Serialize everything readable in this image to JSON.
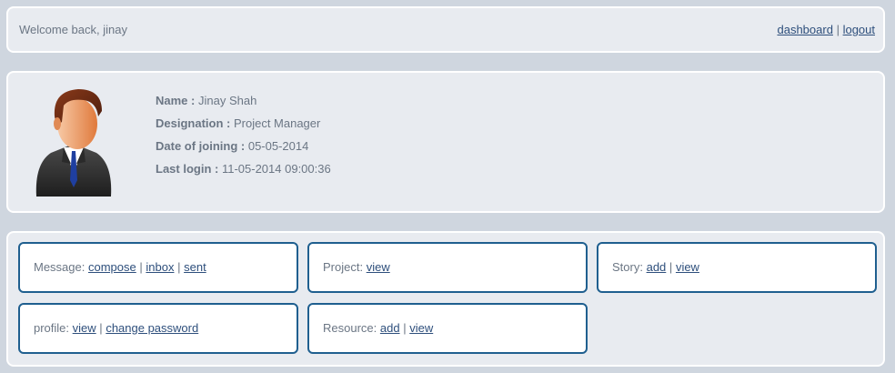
{
  "header": {
    "welcome": "Welcome back, jinay",
    "links": {
      "dashboard": "dashboard",
      "separator": "|",
      "logout": "logout"
    }
  },
  "profile": {
    "avatar_icon": "user-avatar-icon",
    "fields": [
      {
        "label": "Name :",
        "value": "Jinay Shah"
      },
      {
        "label": "Designation :",
        "value": "Project Manager"
      },
      {
        "label": "Date of joining :",
        "value": "05-05-2014"
      },
      {
        "label": "Last login :",
        "value": "11-05-2014 09:00:36"
      }
    ]
  },
  "cards": {
    "message": {
      "label": "Message:",
      "links": [
        "compose",
        "inbox",
        "sent"
      ]
    },
    "project": {
      "label": "Project:",
      "links": [
        "view"
      ]
    },
    "story": {
      "label": "Story:",
      "links": [
        "add",
        "view"
      ]
    },
    "profile": {
      "label": "profile:",
      "links": [
        "view",
        "change password"
      ]
    },
    "resource": {
      "label": "Resource:",
      "links": [
        "add",
        "view"
      ]
    }
  },
  "colors": {
    "background": "#cfd6df",
    "panel": "#e8ebf0",
    "card_border": "#1f5f8f",
    "link": "#2e4f7c",
    "text": "#6b7684"
  }
}
